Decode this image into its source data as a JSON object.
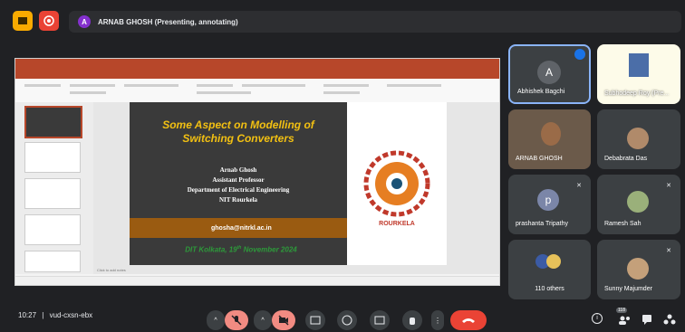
{
  "topbar": {
    "presenter_initial": "A",
    "presenter_text": "ARNAB GHOSH (Presenting, annotating)",
    "colors": {
      "folder_icon": "#f9ab00",
      "record_icon": "#ea4335",
      "avatar": "#8430ce"
    }
  },
  "slide": {
    "title": "Some Aspect on Modelling of Switching Converters",
    "lines": [
      "Arnab Ghosh",
      "Assistant Professor",
      "Department of Electrical Engineering",
      "NIT Rourkela"
    ],
    "email": "ghosha@nitrkl.ac.in",
    "venue_prefix": "DIT Kolkata, 19",
    "venue_sup": "th",
    "venue_suffix": " November 2024",
    "logo_text": "ROURKELA",
    "add_notes": "Click to add notes"
  },
  "participants": [
    {
      "name": "Abhishek Bagchi",
      "initial": "A",
      "avatar_color": "#5f6368"
    },
    {
      "name": "Subhodeep Roy (Pre..."
    },
    {
      "name": "ARNAB GHOSH"
    },
    {
      "name": "Debabrata Das"
    },
    {
      "name": "prashanta Tripathy",
      "initial": "p",
      "avatar_color": "#7b86a8"
    },
    {
      "name": "Ramesh Sah"
    },
    {
      "name": "110 others"
    },
    {
      "name": "Sunny Majumder"
    }
  ],
  "bottombar": {
    "time": "10:27",
    "meeting_code": "vud-cxsn-ebx",
    "participant_count": "118",
    "end_call_color": "#ea4335"
  }
}
